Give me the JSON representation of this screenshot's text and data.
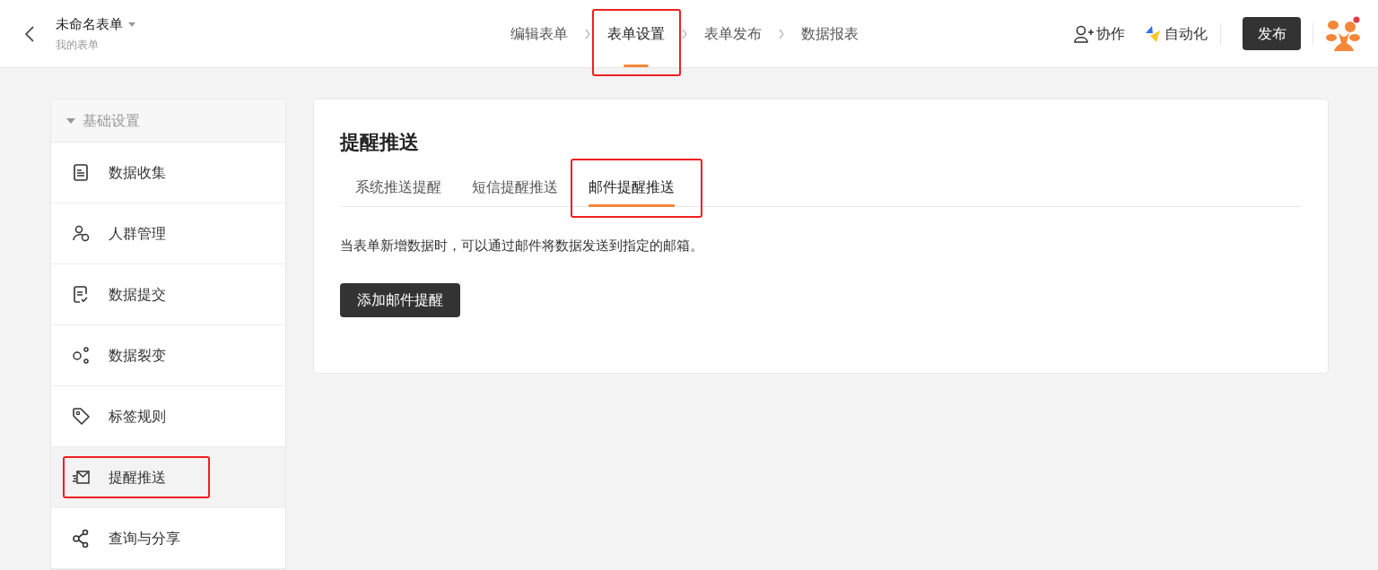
{
  "header": {
    "title": "未命名表单",
    "subtitle": "我的表单",
    "steps": [
      {
        "label": "编辑表单",
        "selected": false,
        "highlighted": false
      },
      {
        "label": "表单设置",
        "selected": true,
        "highlighted": true
      },
      {
        "label": "表单发布",
        "selected": false,
        "highlighted": false
      },
      {
        "label": "数据报表",
        "selected": false,
        "highlighted": false
      }
    ],
    "collaborate": "协作",
    "automation": "自动化",
    "publish": "发布"
  },
  "sidebar": {
    "group": "基础设置",
    "expanded": true,
    "items": [
      {
        "label": "数据收集",
        "selected": false,
        "highlighted": false
      },
      {
        "label": "人群管理",
        "selected": false,
        "highlighted": false
      },
      {
        "label": "数据提交",
        "selected": false,
        "highlighted": false
      },
      {
        "label": "数据裂变",
        "selected": false,
        "highlighted": false
      },
      {
        "label": "标签规则",
        "selected": false,
        "highlighted": false
      },
      {
        "label": "提醒推送",
        "selected": true,
        "highlighted": true
      },
      {
        "label": "查询与分享",
        "selected": false,
        "highlighted": false
      }
    ]
  },
  "panel": {
    "title": "提醒推送",
    "tabs": [
      {
        "label": "系统推送提醒",
        "selected": false,
        "highlighted": false
      },
      {
        "label": "短信提醒推送",
        "selected": false,
        "highlighted": false
      },
      {
        "label": "邮件提醒推送",
        "selected": true,
        "highlighted": true
      }
    ],
    "description": "当表单新增数据时，可以通过邮件将数据发送到指定的邮箱。",
    "button": "添加邮件提醒"
  }
}
